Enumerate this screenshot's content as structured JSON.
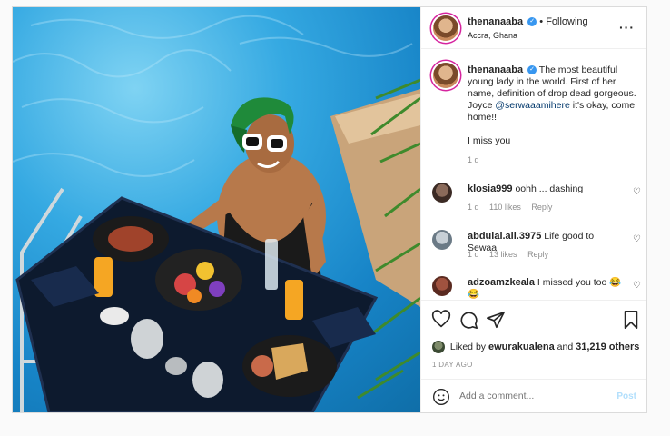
{
  "post": {
    "username": "thenanaaba",
    "following_label": "Following",
    "location": "Accra, Ghana",
    "more_icon": "more-icon",
    "caption": {
      "username": "thenanaaba",
      "text_before": "The most beautiful young lady in the world. First of her name, definition of drop dead gorgeous. Joyce ",
      "mention": "@serwaaamihere",
      "text_after": " it's okay, come home!!",
      "line2": "I miss you",
      "time": "1 d"
    },
    "comments": [
      {
        "username": "klosia999",
        "text": "oohh ... dashing",
        "time": "1 d",
        "likes": "110 likes",
        "reply": "Reply"
      },
      {
        "username": "abdulai.ali.3975",
        "text": "Life good to Sewaa",
        "time": "1 d",
        "likes": "13 likes",
        "reply": "Reply"
      },
      {
        "username": "adzoamzkeala",
        "text": "I missed you too 😂 😂"
      }
    ],
    "liked_by_prefix": "Liked by ",
    "liked_by_user": "ewurakualena",
    "liked_by_suffix": " and ",
    "liked_by_count": "31,219 others",
    "date": "1 DAY AGO",
    "comment_placeholder": "Add a comment...",
    "post_button": "Post"
  },
  "colors": {
    "verified": "#3897f0",
    "link": "#00376b",
    "post_disabled": "#b2dffc",
    "pool": "#35a9e2"
  }
}
